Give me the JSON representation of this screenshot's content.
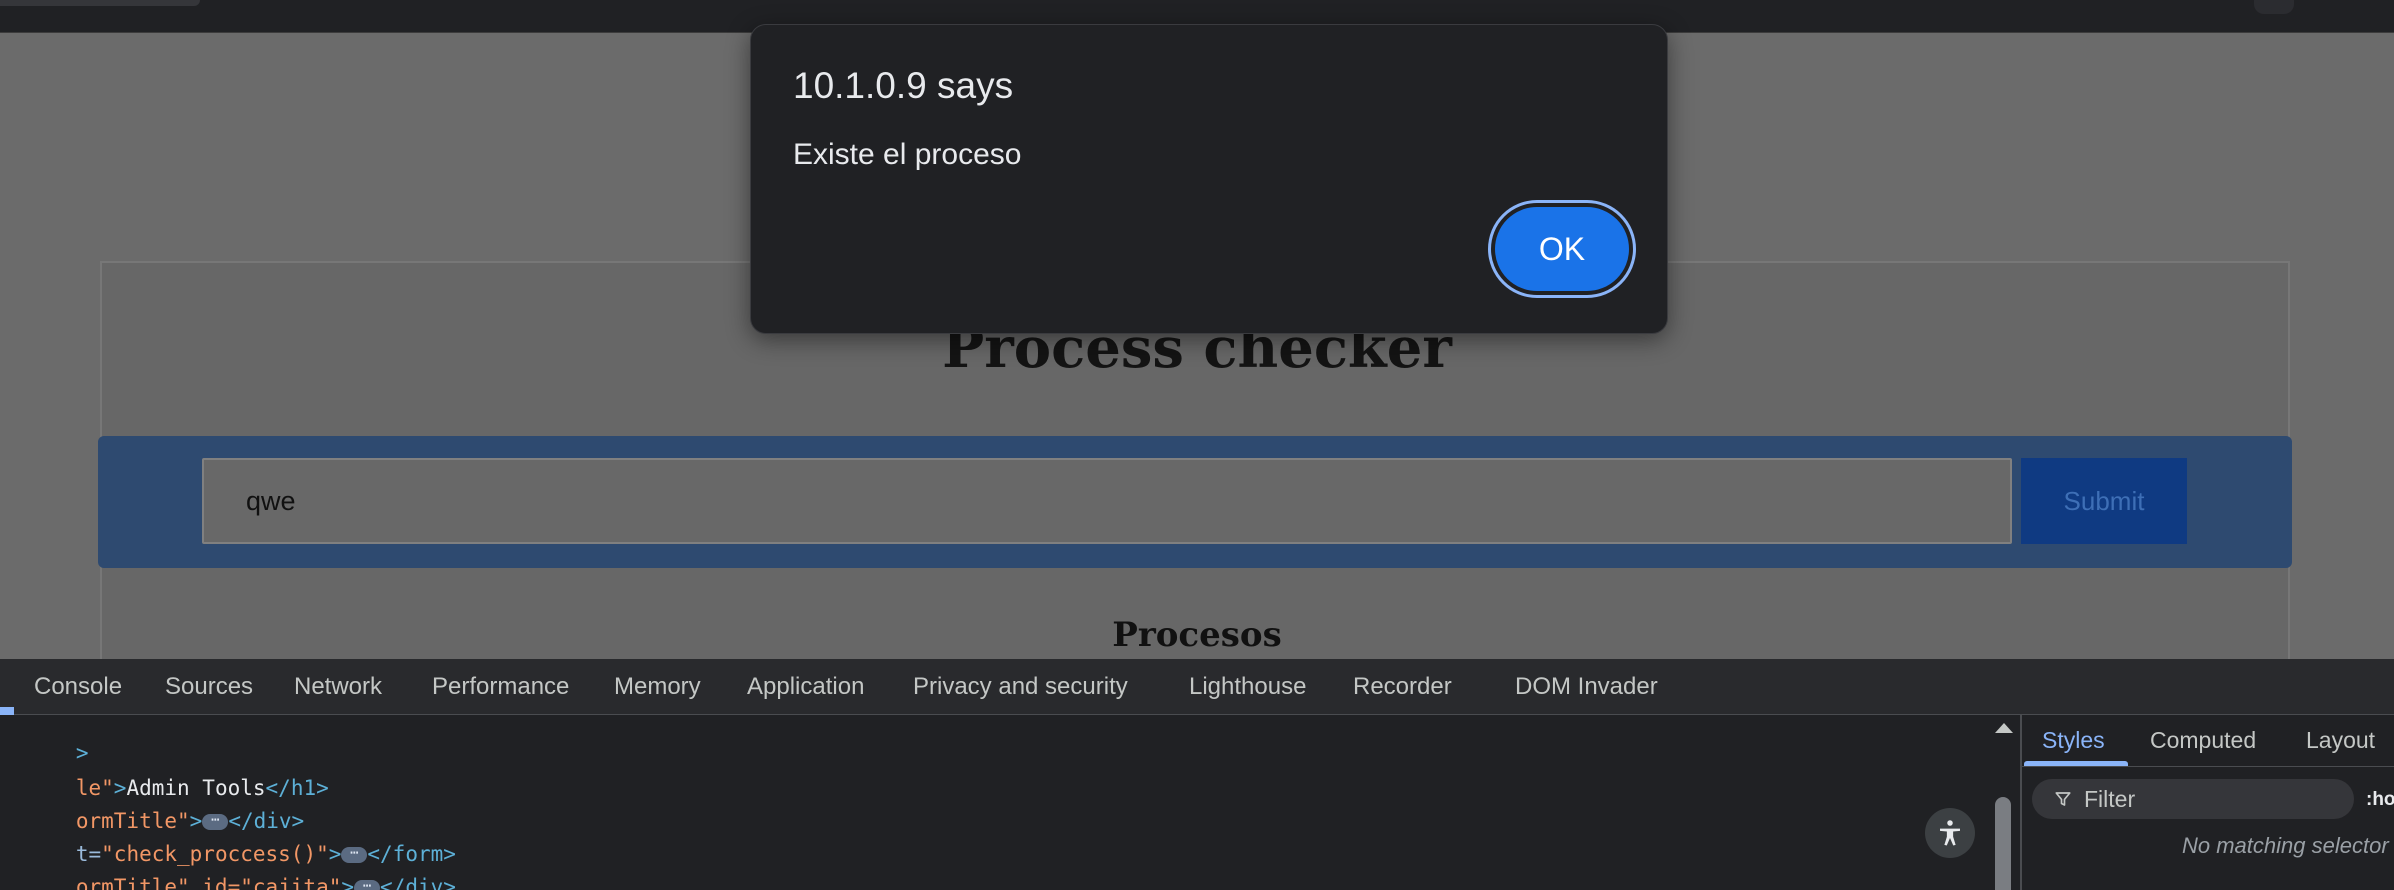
{
  "dialog": {
    "title": "10.1.0.9 says",
    "message": "Existe el proceso",
    "ok_label": "OK"
  },
  "page": {
    "title": "Process checker",
    "input_value": "qwe",
    "submit_label": "Submit",
    "section_title": "Procesos"
  },
  "devtools": {
    "tabs": [
      "Console",
      "Sources",
      "Network",
      "Performance",
      "Memory",
      "Application",
      "Privacy and security",
      "Lighthouse",
      "Recorder",
      "DOM Invader"
    ],
    "code": {
      "line0": ">",
      "line1_attr": "le\"",
      "line1_gt": ">",
      "line1_text": "Admin Tools",
      "line1_close": "</h1>",
      "line2_attr": "ormTitle\"",
      "line2_gt": ">",
      "line2_close": "</div>",
      "line3_attr": "t=",
      "line3_val": "\"check_proccess()\"",
      "line3_gt": ">",
      "line3_close": "</form>",
      "line4_attr": "ormTitle\" id=\"cajita\"",
      "line4_gt": ">",
      "line4_close": "</div>",
      "ellipsis": "⋯"
    },
    "side": {
      "tabs": [
        "Styles",
        "Computed",
        "Layout"
      ],
      "filter_placeholder": "Filter",
      "hov": ":hov",
      "no_match": "No matching selector"
    }
  },
  "icons": {
    "accessibility": "accessibility-icon",
    "filter": "filter-icon",
    "scroll_up": "scroll-up-arrow-icon"
  },
  "colors": {
    "dialog_bg": "#202124",
    "ok_button": "#1a73e8",
    "form_band": "#2e4a70",
    "submit_button": "#0f3a82",
    "devtools_accent": "#8ab4f8"
  }
}
